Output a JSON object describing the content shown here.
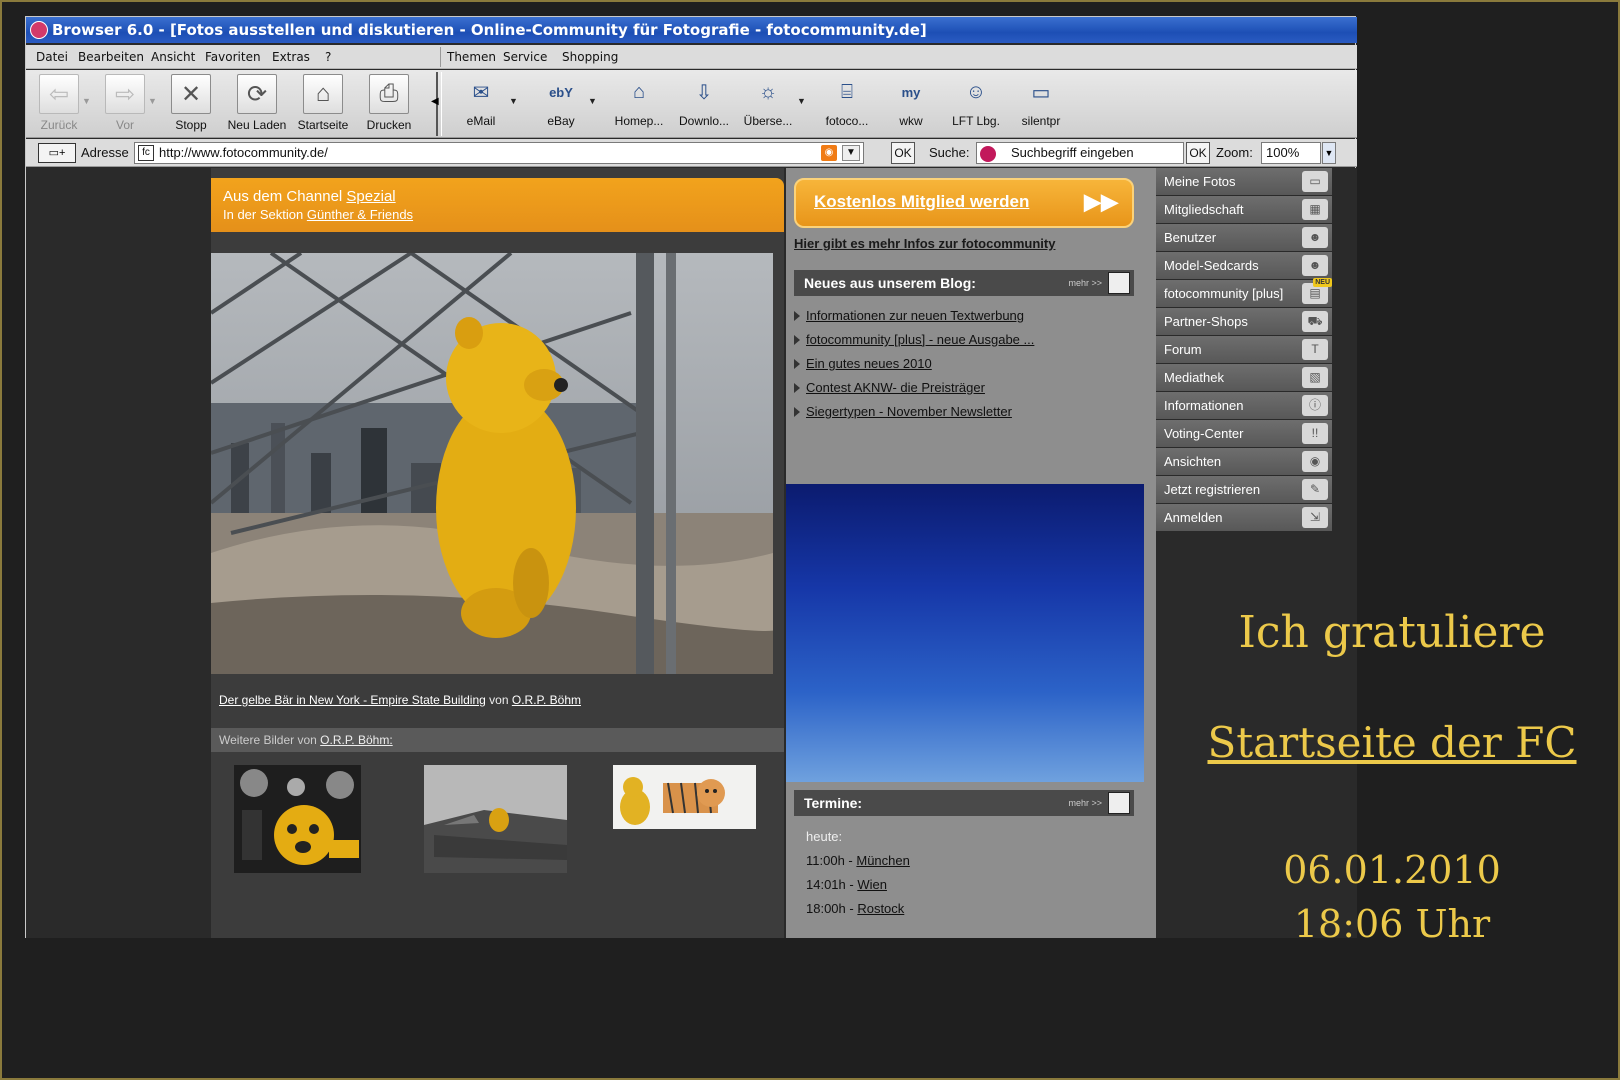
{
  "window": {
    "title": "Browser 6.0 - [Fotos ausstellen und diskutieren - Online-Community für Fotografie - fotocommunity.de]"
  },
  "menu": [
    "Datei",
    "Bearbeiten",
    "Ansicht",
    "Favoriten",
    "Extras",
    "?",
    "Themen",
    "Service",
    "Shopping"
  ],
  "toolbar": {
    "nav": [
      {
        "label": "Zurück",
        "icon": "back-arrow-icon",
        "enabled": false
      },
      {
        "label": "Vor",
        "icon": "forward-arrow-icon",
        "enabled": false
      },
      {
        "label": "Stopp",
        "icon": "stop-icon",
        "enabled": true
      },
      {
        "label": "Neu Laden",
        "icon": "reload-icon",
        "enabled": true
      },
      {
        "label": "Startseite",
        "icon": "home-icon",
        "enabled": true
      },
      {
        "label": "Drucken",
        "icon": "print-icon",
        "enabled": true
      }
    ],
    "links": [
      {
        "label": "eMail",
        "icon": "mail-icon",
        "glyph": "✉"
      },
      {
        "label": "eBay",
        "icon": "ebay-icon",
        "glyph": "ebY"
      },
      {
        "label": "Homep...",
        "icon": "homepage-icon",
        "glyph": "⌂"
      },
      {
        "label": "Downlo...",
        "icon": "download-icon",
        "glyph": "⇩"
      },
      {
        "label": "Überse...",
        "icon": "translate-icon",
        "glyph": "☼"
      },
      {
        "label": "fotoco...",
        "icon": "bank-icon",
        "glyph": "⌸"
      },
      {
        "label": "wkw",
        "icon": "folder-my-icon",
        "glyph": "my"
      },
      {
        "label": "LFT Lbg.",
        "icon": "people-icon",
        "glyph": "☺"
      },
      {
        "label": "silentpr",
        "icon": "car-icon",
        "glyph": "▭"
      }
    ]
  },
  "address": {
    "label": "Adresse",
    "url": "http://www.fotocommunity.de/",
    "ok": "OK"
  },
  "search": {
    "label": "Suche:",
    "placeholder": "Suchbegriff eingeben",
    "ok": "OK"
  },
  "zoom": {
    "label": "Zoom:",
    "value": "100%"
  },
  "channel": {
    "prefix": "Aus dem Channel",
    "name": "Spezial",
    "section_prefix": "In der Sektion",
    "section": "Günther & Friends"
  },
  "photo": {
    "title": "Der gelbe Bär in New York - Empire State Building",
    "by": "von",
    "author": "O.R.P. Böhm"
  },
  "more_photos": {
    "prefix": "Weitere Bilder von",
    "author": "O.R.P. Böhm:"
  },
  "sidebar": {
    "cta": "Kostenlos Mitglied werden",
    "infos_link": "Hier gibt es mehr Infos zur fotocommunity",
    "blog_heading": "Neues aus unserem Blog:",
    "blog_more": "mehr >>",
    "blog_items": [
      "Informationen zur neuen Textwerbung",
      "fotocommunity [plus] - neue Ausgabe ...",
      "Ein gutes neues 2010",
      "Contest AKNW- die Preisträger",
      "Siegertypen - November Newsletter"
    ],
    "termine_heading": "Termine:",
    "termine_more": "mehr >>",
    "termine_today": "heute:",
    "termine": [
      {
        "time": "11:00h -",
        "city": "München"
      },
      {
        "time": "14:01h -",
        "city": "Wien"
      },
      {
        "time": "18:00h -",
        "city": "Rostock"
      }
    ]
  },
  "nav_items": [
    {
      "label": "Meine Fotos",
      "icon": "photos-icon",
      "glyph": "▭"
    },
    {
      "label": "Mitgliedschaft",
      "icon": "membership-icon",
      "glyph": "▦"
    },
    {
      "label": "Benutzer",
      "icon": "users-icon",
      "glyph": "☻"
    },
    {
      "label": "Model-Sedcards",
      "icon": "sedcard-icon",
      "glyph": "☻"
    },
    {
      "label": "fotocommunity [plus]",
      "icon": "magazine-icon",
      "glyph": "▤",
      "badge": "NEU"
    },
    {
      "label": "Partner-Shops",
      "icon": "cart-icon",
      "glyph": "⛟"
    },
    {
      "label": "Forum",
      "icon": "forum-icon",
      "glyph": "T"
    },
    {
      "label": "Mediathek",
      "icon": "media-icon",
      "glyph": "▧"
    },
    {
      "label": "Informationen",
      "icon": "info-icon",
      "glyph": "ⓘ"
    },
    {
      "label": "Voting-Center",
      "icon": "voting-icon",
      "glyph": "!!"
    },
    {
      "label": "Ansichten",
      "icon": "eye-icon",
      "glyph": "◉"
    },
    {
      "label": "Jetzt registrieren",
      "icon": "pencil-icon",
      "glyph": "✎"
    },
    {
      "label": "Anmelden",
      "icon": "login-icon",
      "glyph": "⇲"
    }
  ],
  "overlay": {
    "line1": "Ich gratuliere",
    "line2": "Startseite der FC",
    "date": "06.01.2010",
    "time": "18:06 Uhr"
  },
  "colors": {
    "accent": "#e8951a",
    "overlay_text": "#ecc94a",
    "titlebar": "#1d4fb5"
  }
}
